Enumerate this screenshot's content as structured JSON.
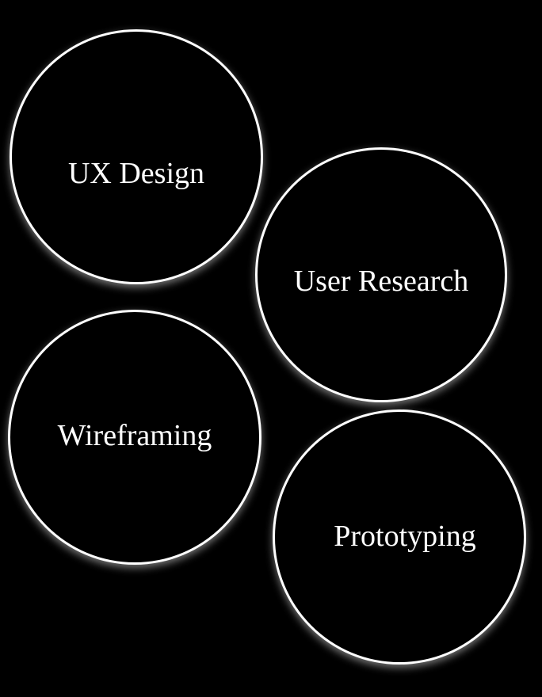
{
  "bubbles": [
    {
      "label": "UX Design"
    },
    {
      "label": "User Research"
    },
    {
      "label": "Wireframing"
    },
    {
      "label": "Prototyping"
    }
  ],
  "colors": {
    "background": "#000000",
    "stroke": "#ffffff",
    "text": "#ffffff"
  }
}
